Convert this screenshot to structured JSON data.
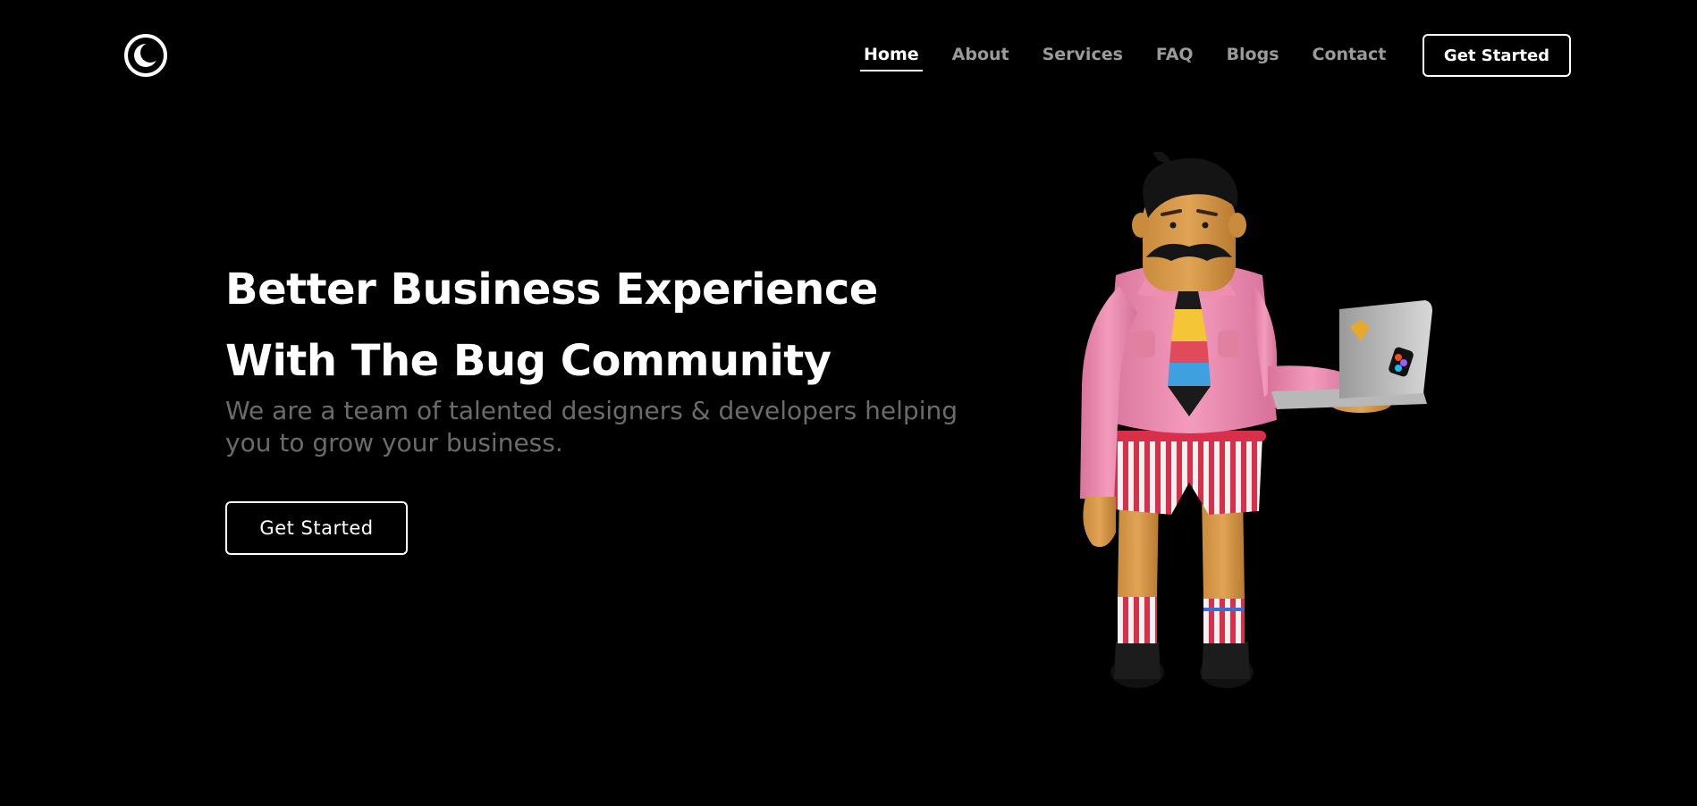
{
  "header": {
    "logo_icon": "crescent-moon-ring-icon",
    "nav": [
      {
        "label": "Home",
        "active": true
      },
      {
        "label": "About",
        "active": false
      },
      {
        "label": "Services",
        "active": false
      },
      {
        "label": "FAQ",
        "active": false
      },
      {
        "label": "Blogs",
        "active": false
      },
      {
        "label": "Contact",
        "active": false
      }
    ],
    "cta_label": "Get Started"
  },
  "hero": {
    "title_line1": "Better Business Experience",
    "title_line2": "With The Bug Community",
    "subtitle": "We are a team of talented designers & developers helping you to grow your business.",
    "cta_label": "Get Started"
  },
  "colors": {
    "background": "#000000",
    "text_primary": "#ffffff",
    "nav_inactive": "#9a9a9a",
    "subtitle": "#6b6b6b"
  }
}
